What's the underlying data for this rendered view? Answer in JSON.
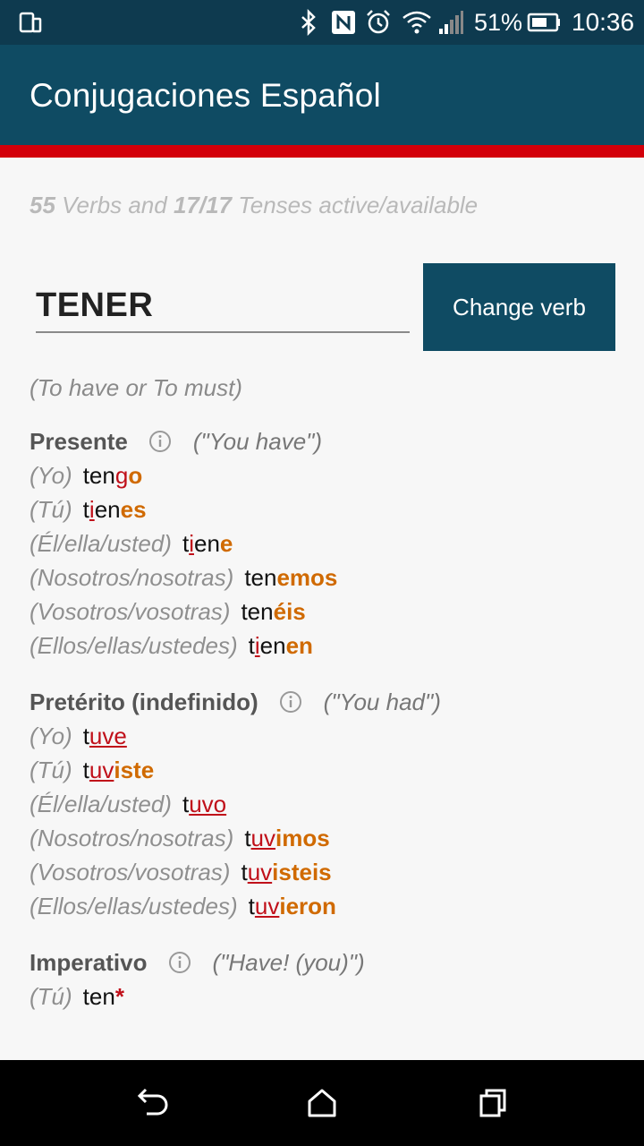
{
  "status": {
    "battery": "51%",
    "time": "10:36"
  },
  "app": {
    "title": "Conjugaciones Español"
  },
  "summary": {
    "verbs_count": "55",
    "verbs_text": "Verbs and",
    "tenses_count": "17/17",
    "tenses_text": "Tenses active/available"
  },
  "verb": {
    "name": "TENER",
    "change_label": "Change verb",
    "meaning": "(To have or To must)"
  },
  "tenses": [
    {
      "name": "Presente",
      "translation": "(\"You have\")",
      "rows": [
        {
          "pronoun": "(Yo)",
          "parts": [
            [
              "n",
              "ten"
            ],
            [
              "i",
              "g"
            ],
            [
              "e",
              "o"
            ]
          ]
        },
        {
          "pronoun": "(Tú)",
          "parts": [
            [
              "n",
              "t"
            ],
            [
              "i",
              "i"
            ],
            [
              "n",
              "en"
            ],
            [
              "e",
              "es"
            ]
          ]
        },
        {
          "pronoun": "(Él/ella/usted)",
          "parts": [
            [
              "n",
              "t"
            ],
            [
              "i",
              "i"
            ],
            [
              "n",
              "en"
            ],
            [
              "e",
              "e"
            ]
          ]
        },
        {
          "pronoun": "(Nosotros/nosotras)",
          "parts": [
            [
              "n",
              "ten"
            ],
            [
              "e",
              "emos"
            ]
          ]
        },
        {
          "pronoun": "(Vosotros/vosotras)",
          "parts": [
            [
              "n",
              "ten"
            ],
            [
              "e",
              "éis"
            ]
          ]
        },
        {
          "pronoun": "(Ellos/ellas/ustedes)",
          "parts": [
            [
              "n",
              "t"
            ],
            [
              "i",
              "i"
            ],
            [
              "n",
              "en"
            ],
            [
              "e",
              "en"
            ]
          ]
        }
      ]
    },
    {
      "name": "Pretérito (indefinido)",
      "translation": "(\"You had\")",
      "rows": [
        {
          "pronoun": "(Yo)",
          "parts": [
            [
              "n",
              "t"
            ],
            [
              "i",
              "uve"
            ]
          ]
        },
        {
          "pronoun": "(Tú)",
          "parts": [
            [
              "n",
              "t"
            ],
            [
              "i",
              "uv"
            ],
            [
              "e",
              "iste"
            ]
          ]
        },
        {
          "pronoun": "(Él/ella/usted)",
          "parts": [
            [
              "n",
              "t"
            ],
            [
              "i",
              "uvo"
            ]
          ]
        },
        {
          "pronoun": "(Nosotros/nosotras)",
          "parts": [
            [
              "n",
              "t"
            ],
            [
              "i",
              "uv"
            ],
            [
              "e",
              "imos"
            ]
          ]
        },
        {
          "pronoun": "(Vosotros/vosotras)",
          "parts": [
            [
              "n",
              "t"
            ],
            [
              "i",
              "uv"
            ],
            [
              "e",
              "isteis"
            ]
          ]
        },
        {
          "pronoun": "(Ellos/ellas/ustedes)",
          "parts": [
            [
              "n",
              "t"
            ],
            [
              "i",
              "uv"
            ],
            [
              "e",
              "ieron"
            ]
          ]
        }
      ]
    },
    {
      "name": "Imperativo",
      "translation": "(\"Have! (you)\")",
      "rows": [
        {
          "pronoun": "(Tú)",
          "parts": [
            [
              "n",
              "ten"
            ],
            [
              "a",
              "*"
            ]
          ]
        }
      ]
    }
  ],
  "icons": {
    "status_left": "screen-rotate-icon",
    "status_right": [
      "bluetooth-icon",
      "nfc-icon",
      "alarm-icon",
      "wifi-icon",
      "signal-icon",
      "battery-icon"
    ],
    "nav": [
      "back-icon",
      "home-icon",
      "recents-icon"
    ],
    "tense_info": "info-icon"
  },
  "colors": {
    "primary": "#0f4b63",
    "accent_bar": "#d3000a",
    "irregular": "#c0101a",
    "ending": "#d06a00"
  }
}
